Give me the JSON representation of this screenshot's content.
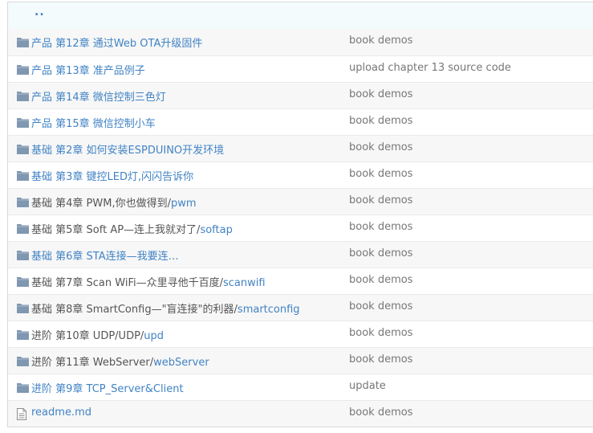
{
  "file_list": {
    "up_label": "..",
    "rows": [
      {
        "type": "dir",
        "prefix": "",
        "link": "产品 第12章 通过Web OTA升级固件",
        "message": "book demos"
      },
      {
        "type": "dir",
        "prefix": "",
        "link": "产品 第13章 准产品例子",
        "message": "upload chapter 13 source code"
      },
      {
        "type": "dir",
        "prefix": "",
        "link": "产品 第14章 微信控制三色灯",
        "message": "book demos"
      },
      {
        "type": "dir",
        "prefix": "",
        "link": "产品 第15章 微信控制小车",
        "message": "book demos"
      },
      {
        "type": "dir",
        "prefix": "",
        "link": "基础 第2章 如何安装ESPDUINO开发环境",
        "message": "book demos"
      },
      {
        "type": "dir",
        "prefix": "",
        "link": "基础 第3章 键控LED灯,闪闪告诉你",
        "message": "book demos"
      },
      {
        "type": "dir",
        "prefix": "基础 第4章 PWM,你也做得到/",
        "link": "pwm",
        "message": "book demos"
      },
      {
        "type": "dir",
        "prefix": "基础 第5章 Soft AP—连上我就对了/",
        "link": "softap",
        "message": "book demos"
      },
      {
        "type": "dir",
        "prefix": "",
        "link": "基础 第6章 STA连接—我要连…",
        "message": "book demos"
      },
      {
        "type": "dir",
        "prefix": "基础 第7章 Scan WiFi—众里寻他千百度/",
        "link": "scanwifi",
        "message": "book demos"
      },
      {
        "type": "dir",
        "prefix": "基础 第8章 SmartConfig—\"盲连接\"的利器/",
        "link": "smartconfig",
        "message": "book demos"
      },
      {
        "type": "dir",
        "prefix": "进阶 第10章 UDP/UDP/",
        "link": "upd",
        "message": "book demos"
      },
      {
        "type": "dir",
        "prefix": "进阶 第11章 WebServer/",
        "link": "webServer",
        "message": "book demos"
      },
      {
        "type": "dir",
        "prefix": "",
        "link": "进阶 第9章 TCP_Server&Client",
        "message": "update"
      },
      {
        "type": "file",
        "prefix": "",
        "link": "readme.md",
        "message": "book demos"
      }
    ]
  },
  "colors": {
    "link": "#4183c4",
    "folder_icon": "#7f97b1",
    "file_icon": "#8d8d8d",
    "muted": "#777777"
  }
}
